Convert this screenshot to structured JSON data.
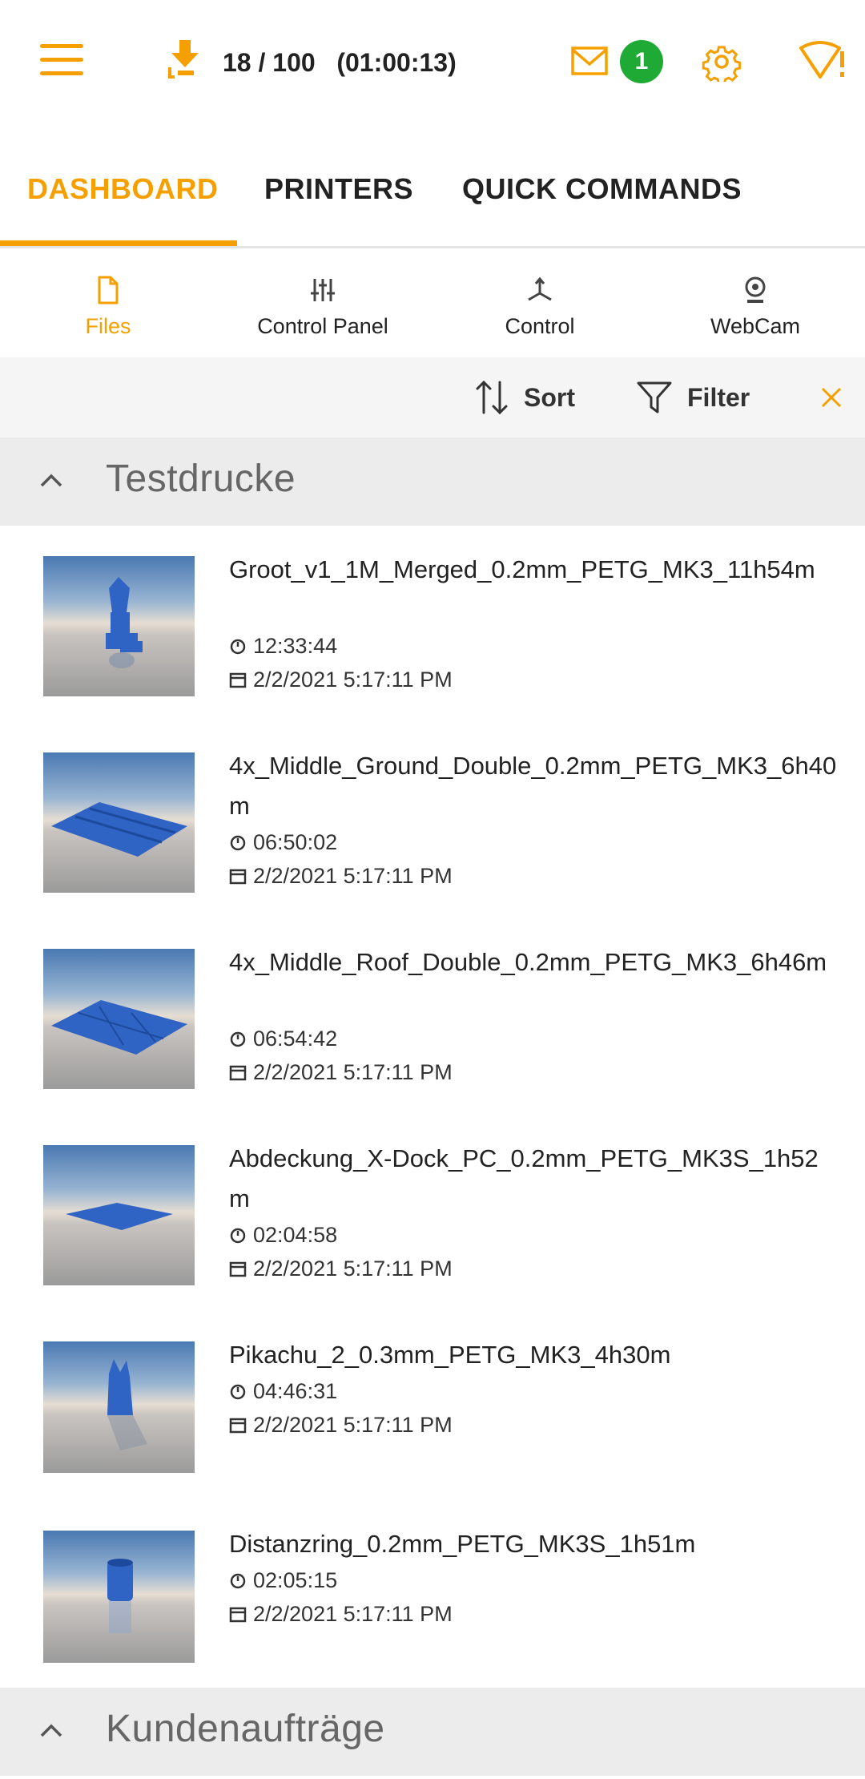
{
  "header": {
    "job_progress": "18 / 100   (01:00:13)",
    "notification_count": "1"
  },
  "tabs": [
    {
      "label": "DASHBOARD",
      "active": true
    },
    {
      "label": "PRINTERS",
      "active": false
    },
    {
      "label": "QUICK COMMANDS",
      "active": false
    }
  ],
  "subnav": [
    {
      "label": "Files",
      "icon": "file-icon",
      "active": true
    },
    {
      "label": "Control Panel",
      "icon": "sliders-icon",
      "active": false
    },
    {
      "label": "Control",
      "icon": "axes-icon",
      "active": false
    },
    {
      "label": "WebCam",
      "icon": "webcam-icon",
      "active": false
    }
  ],
  "toolbar": {
    "sort_label": "Sort",
    "filter_label": "Filter"
  },
  "groups": [
    {
      "title": "Testdrucke",
      "expanded": true
    },
    {
      "title": "Kundenaufträge",
      "expanded": true
    }
  ],
  "files": [
    {
      "name": "Groot_v1_1M_Merged_0.2mm_PETG_MK3_11h54m",
      "duration": "12:33:44",
      "date": "2/2/2021 5:17:11 PM"
    },
    {
      "name": "4x_Middle_Ground_Double_0.2mm_PETG_MK3_6h40m",
      "duration": "06:50:02",
      "date": "2/2/2021 5:17:11 PM"
    },
    {
      "name": "4x_Middle_Roof_Double_0.2mm_PETG_MK3_6h46m",
      "duration": "06:54:42",
      "date": "2/2/2021 5:17:11 PM"
    },
    {
      "name": "Abdeckung_X-Dock_PC_0.2mm_PETG_MK3S_1h52m",
      "duration": "02:04:58",
      "date": "2/2/2021 5:17:11 PM"
    },
    {
      "name": "Pikachu_2_0.3mm_PETG_MK3_4h30m",
      "duration": "04:46:31",
      "date": "2/2/2021 5:17:11 PM"
    },
    {
      "name": "Distanzring_0.2mm_PETG_MK3S_1h51m",
      "duration": "02:05:15",
      "date": "2/2/2021 5:17:11 PM"
    }
  ],
  "colors": {
    "accent": "#f5a000",
    "badge": "#1faa35",
    "model": "#2f63c4"
  }
}
